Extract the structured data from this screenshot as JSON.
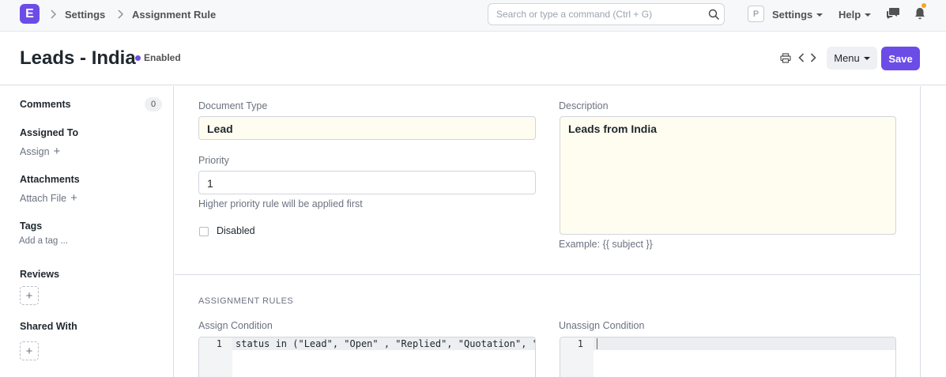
{
  "navbar": {
    "logo_letter": "E",
    "breadcrumbs": [
      "Settings",
      "Assignment Rule"
    ],
    "search_placeholder": "Search or type a command (Ctrl + G)",
    "avatar_letter": "P",
    "settings_label": "Settings",
    "help_label": "Help",
    "accent_color": "#6c4ce6",
    "notification_dot_color": "#f5a623"
  },
  "page_head": {
    "title": "Leads - India",
    "status": "Enabled",
    "menu_label": "Menu",
    "save_label": "Save"
  },
  "sidebar": {
    "comments_label": "Comments",
    "comments_count": "0",
    "assigned_to_label": "Assigned To",
    "assign_link": "Assign",
    "attachments_label": "Attachments",
    "attach_link": "Attach File",
    "tags_label": "Tags",
    "add_tag_link": "Add a tag ...",
    "reviews_label": "Reviews",
    "shared_with_label": "Shared With"
  },
  "form": {
    "document_type_label": "Document Type",
    "document_type_value": "Lead",
    "priority_label": "Priority",
    "priority_value": "1",
    "priority_help": "Higher priority rule will be applied first",
    "disabled_label": "Disabled",
    "description_label": "Description",
    "description_value": "Leads from India",
    "description_help": "Example: {{ subject }}"
  },
  "assignment_rules": {
    "section_title": "ASSIGNMENT RULES",
    "assign_condition_label": "Assign Condition",
    "assign_condition_line_no": "1",
    "assign_condition_code": "status in (\"Lead\", \"Open\" , \"Replied\", \"Quotation\", \"",
    "unassign_condition_label": "Unassign Condition",
    "unassign_condition_line_no": "1",
    "unassign_condition_code": ""
  }
}
